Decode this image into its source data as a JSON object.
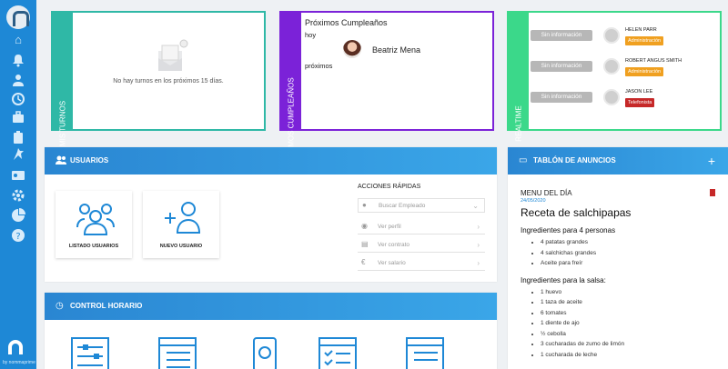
{
  "sidebar": {
    "icons": [
      "home-icon",
      "bell-icon",
      "users-icon",
      "clock-icon",
      "briefcase-icon",
      "clipboard-icon",
      "pin-icon",
      "id-card-icon",
      "settings-icon",
      "chart-icon",
      "help-icon"
    ],
    "brand": "by nommaprime"
  },
  "widgets": {
    "turnos": {
      "label": "MIS TURNOS",
      "empty_text": "No hay turnos en los próximos 15 días."
    },
    "cumpleanos": {
      "label": "PRÓXIMOS CUMPLEAÑOS",
      "title": "Próximos Cumpleaños",
      "hoy": "hoy",
      "person": "Beatriz Mena",
      "proximos": "próximos"
    },
    "realtime": {
      "label": "REALTIME",
      "rows": [
        {
          "status": "Sin información",
          "name": "HELEN PARR",
          "role": "Administración",
          "role_color": "#f0a020"
        },
        {
          "status": "Sin información",
          "name": "ROBERT ANGUS SMITH",
          "role": "Administración",
          "role_color": "#f0a020"
        },
        {
          "status": "Sin información",
          "name": "JASON LEE",
          "role": "Telefonista",
          "role_color": "#c62828"
        }
      ]
    }
  },
  "usuarios": {
    "title": "USUARIOS",
    "tiles": [
      {
        "label": "LISTADO USUARIOS"
      },
      {
        "label": "NUEVO USUARIO"
      }
    ],
    "quick": {
      "title": "ACCIONES RÁPIDAS",
      "search_placeholder": "Buscar Empleado",
      "actions": [
        {
          "label": "Ver perfil"
        },
        {
          "label": "Ver contrato"
        },
        {
          "label": "Ver salario"
        }
      ]
    }
  },
  "tablon": {
    "title": "TABLÓN DE ANUNCIOS",
    "add": "+",
    "post": {
      "title": "MENU DEL DÍA",
      "date": "24/05/2020",
      "heading": "Receta de salchipapas",
      "section1": "Ingredientes para 4 personas",
      "list1": [
        "4 patatas grandes",
        "4 salchichas grandes",
        "Aceite para freír"
      ],
      "section2": "Ingredientes para la salsa:",
      "list2": [
        "1 huevo",
        "1 taza de aceite",
        "6 tomates",
        "1 diente de ajo",
        "½ cebolla",
        "3 cucharadas de zumo de limón",
        "1 cucharada de leche"
      ]
    }
  },
  "control": {
    "title": "CONTROL HORARIO"
  },
  "colors": {
    "primary": "#1e88d6",
    "turnos": "#2fb8a6",
    "cumple": "#7b22d8",
    "realtime": "#3bd88a"
  }
}
